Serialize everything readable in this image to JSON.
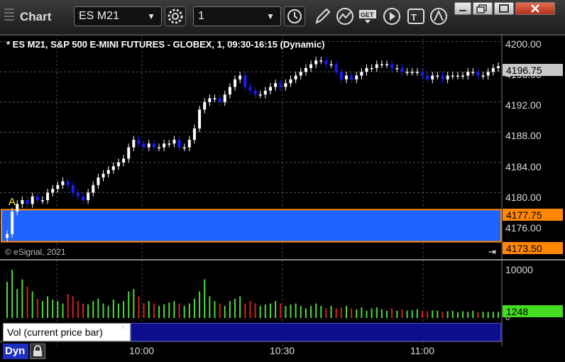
{
  "window": {
    "title": "Chart",
    "symbol": "ES M21",
    "interval": "1"
  },
  "chart": {
    "title": "* ES M21, S&P 500 E-MINI FUTURES - GLOBEX, 1, 09:30-16:15 (Dynamic)",
    "copyright": "© eSignal, 2021",
    "annotation_letter": "A",
    "current_price": "4196.75",
    "zone_high": "4177.75",
    "zone_low": "4173.50",
    "volume_current": "1248",
    "volume_pane_label": "Vol (current price bar)",
    "volume_pane_close": "×",
    "dyn_label": "Dyn",
    "colors": {
      "up": "#ffffff",
      "down": "#1a1aff",
      "zone": "#1f64ff",
      "zone_border": "#ff8800",
      "volume_tag": "#44dd22"
    }
  },
  "chart_data": {
    "type": "candlestick",
    "price_ticks": [
      "4200.00",
      "4196.00",
      "4192.00",
      "4188.00",
      "4184.00",
      "4180.00",
      "4176.00"
    ],
    "volume_ticks": [
      "10000",
      "0"
    ],
    "time_ticks": [
      "10:00",
      "10:30",
      "11:00"
    ],
    "ylim": [
      4172.8,
      4201.0
    ],
    "close_series": [
      4174.5,
      4177.5,
      4178.5,
      4179,
      4178.5,
      4179.5,
      4179,
      4179,
      4180,
      4180.5,
      4181,
      4181.5,
      4181,
      4180,
      4179.5,
      4179,
      4180,
      4181,
      4182,
      4182.5,
      4183,
      4183.5,
      4184,
      4184.5,
      4186,
      4187,
      4186.5,
      4186,
      4186.5,
      4186,
      4186,
      4186.5,
      4186.5,
      4187,
      4186,
      4186,
      4187,
      4188.5,
      4191,
      4192,
      4192.5,
      4192.5,
      4192,
      4193,
      4194,
      4195,
      4195.5,
      4194,
      4193.5,
      4193,
      4193,
      4193.5,
      4194,
      4194.5,
      4194,
      4194.5,
      4195,
      4195.5,
      4196,
      4196.5,
      4197,
      4197.5,
      4197.5,
      4197,
      4197,
      4196,
      4195,
      4195.5,
      4195,
      4195.5,
      4196,
      4196.5,
      4196.5,
      4197,
      4197,
      4197,
      4196.5,
      4196.5,
      4196,
      4196,
      4196,
      4196,
      4195.5,
      4195,
      4195.5,
      4195.5,
      4195,
      4195.5,
      4195.5,
      4195.5,
      4195.5,
      4196,
      4196,
      4195.5,
      4195.5,
      4196,
      4196.5,
      4196.75
    ],
    "volume_series": [
      7500,
      10000,
      6000,
      8000,
      6500,
      5500,
      4000,
      3500,
      4500,
      3800,
      3500,
      3000,
      5000,
      4500,
      3500,
      3000,
      2800,
      3500,
      4000,
      3000,
      2500,
      3800,
      3000,
      3500,
      5500,
      6000,
      4500,
      3000,
      3500,
      3000,
      2500,
      2800,
      3200,
      3500,
      3000,
      2500,
      3000,
      4000,
      5500,
      8000,
      4500,
      3500,
      3000,
      2500,
      3500,
      4000,
      4500,
      3000,
      3500,
      3000,
      2500,
      2800,
      3000,
      3500,
      3000,
      2500,
      2800,
      3000,
      2500,
      2000,
      2500,
      3000,
      2500,
      2000,
      2500,
      2000,
      2200,
      2500,
      2000,
      1800,
      2200,
      1500,
      2000,
      2200,
      1800,
      1500,
      2000,
      1500,
      1800,
      1500,
      1600,
      1800,
      1500,
      1400,
      1600,
      1500,
      1300,
      1400,
      1500,
      1200,
      1400,
      1300,
      1500,
      1200,
      1300,
      1250,
      1300,
      1248
    ]
  }
}
